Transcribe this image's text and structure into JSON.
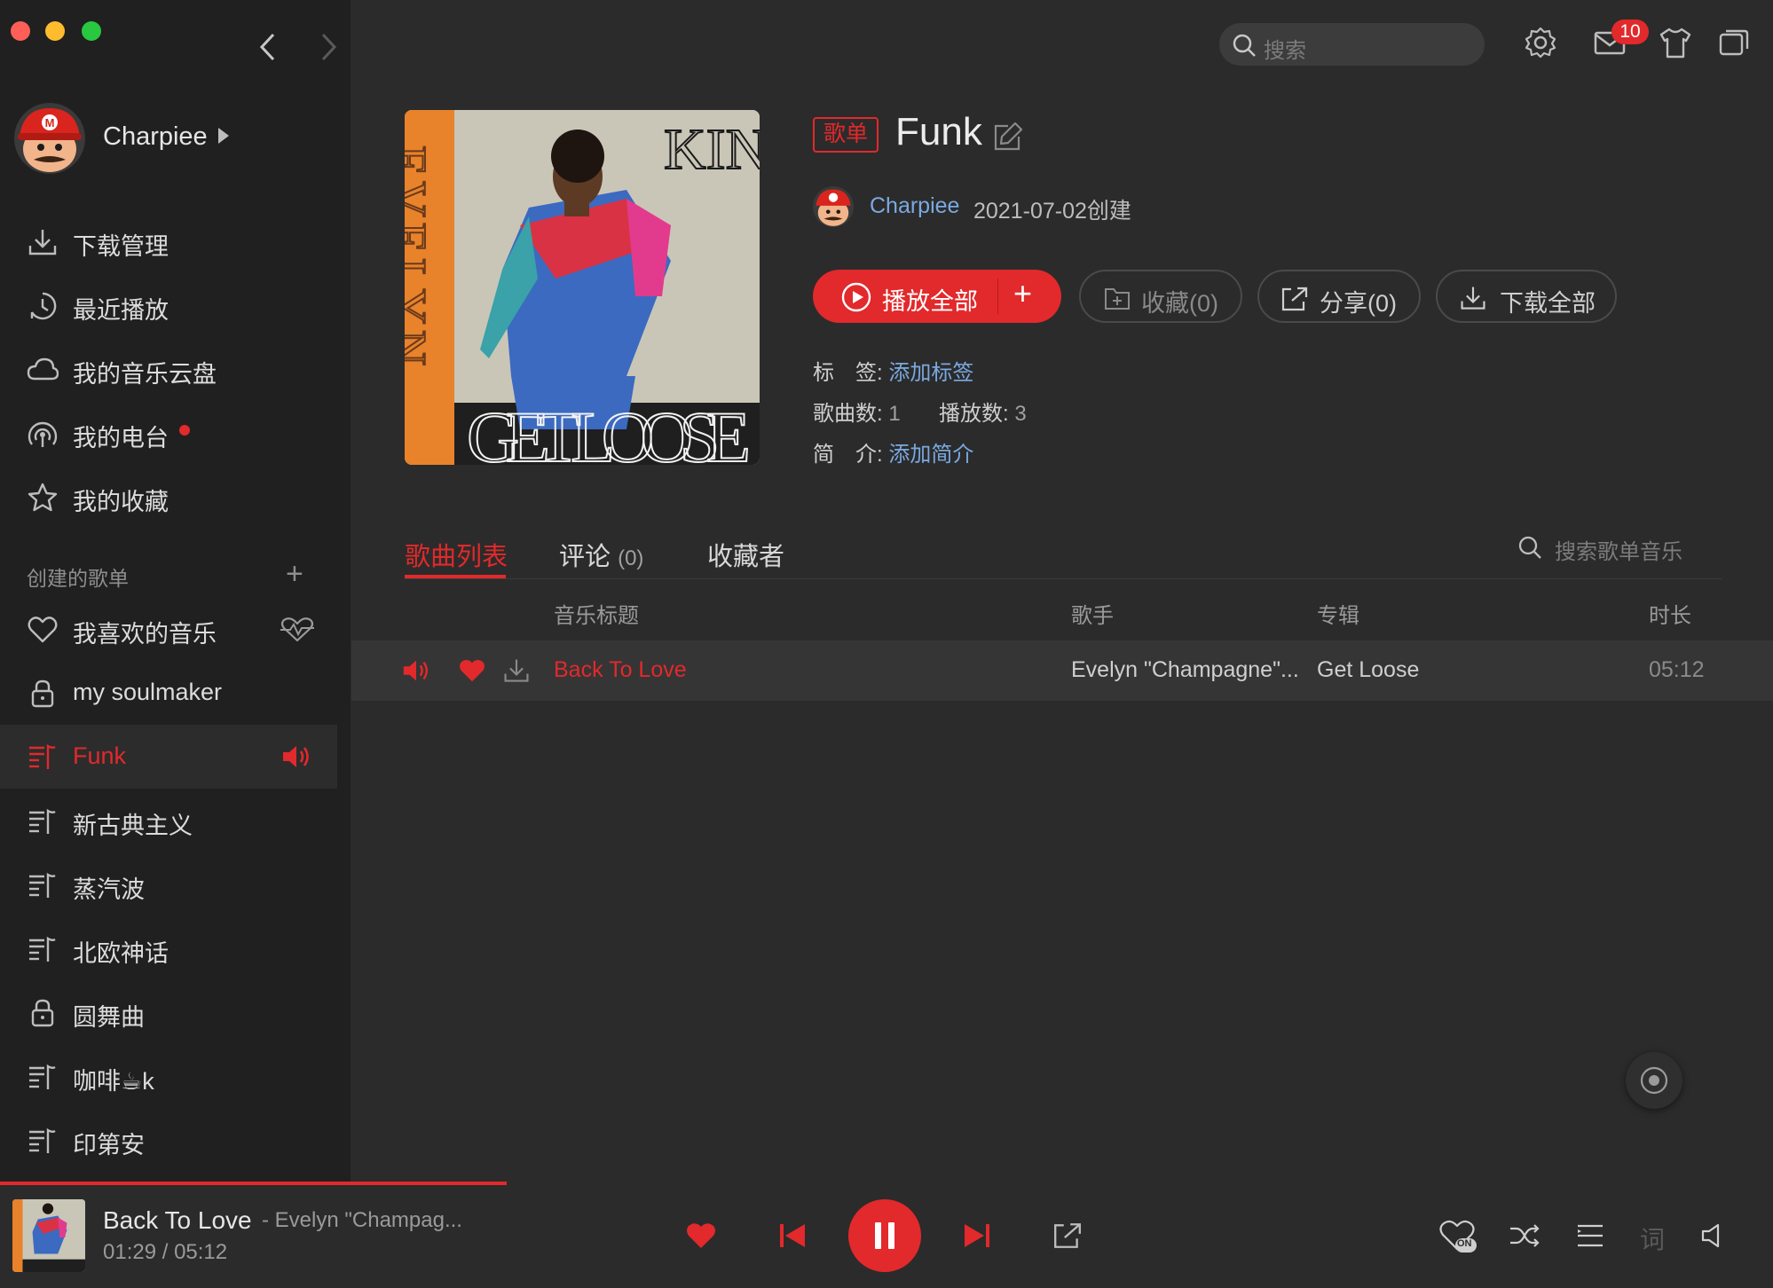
{
  "window": {
    "traffic_colors": [
      "#ff5f57",
      "#febc2e",
      "#28c840"
    ]
  },
  "header": {
    "search_placeholder": "搜索",
    "mail_badge": "10",
    "icons": [
      "chevron-left-icon",
      "chevron-right-icon",
      "search-icon",
      "gear-icon",
      "mail-icon",
      "tshirt-icon",
      "mini-window-icon"
    ]
  },
  "sidebar": {
    "user": {
      "name": "Charpiee"
    },
    "menu": [
      {
        "label": "下载管理",
        "icon": "download-icon"
      },
      {
        "label": "最近播放",
        "icon": "recent-icon"
      },
      {
        "label": "我的音乐云盘",
        "icon": "cloud-icon"
      },
      {
        "label": "我的电台",
        "icon": "radio-icon",
        "dot": true
      },
      {
        "label": "我的收藏",
        "icon": "star-icon"
      }
    ],
    "created_section": "创建的歌单",
    "playlists": [
      {
        "label": "我喜欢的音乐",
        "icon": "heart-icon"
      },
      {
        "label": "my soulmaker",
        "icon": "lock-icon"
      },
      {
        "label": "Funk",
        "icon": "playlist-icon",
        "active": true
      },
      {
        "label": "新古典主义",
        "icon": "playlist-icon"
      },
      {
        "label": "蒸汽波",
        "icon": "playlist-icon"
      },
      {
        "label": "北欧神话",
        "icon": "playlist-icon"
      },
      {
        "label": "圆舞曲",
        "icon": "lock-icon"
      },
      {
        "label": "咖啡☕k",
        "icon": "playlist-icon"
      },
      {
        "label": "印第安",
        "icon": "playlist-icon"
      }
    ]
  },
  "playlist": {
    "tag": "歌单",
    "title": "Funk",
    "creator": "Charpiee",
    "created": "2021-07-02创建",
    "cover_text_top": "KING",
    "cover_text_side": "EVELYN",
    "cover_text_bottom": "GET LOOSE",
    "buttons": {
      "play_all": "播放全部",
      "add": "+",
      "collect": "收藏(0)",
      "share": "分享(0)",
      "download_all": "下载全部"
    },
    "tags_label": "标　签:",
    "tags_link": "添加标签",
    "count_label": "歌曲数:",
    "count_value": "1",
    "plays_label": "播放数:",
    "plays_value": "3",
    "intro_label": "简　介:",
    "intro_link": "添加简介"
  },
  "tabs": [
    {
      "label": "歌曲列表",
      "active": true
    },
    {
      "label": "评论",
      "count": "(0)"
    },
    {
      "label": "收藏者"
    }
  ],
  "list_search_placeholder": "搜索歌单音乐",
  "table": {
    "columns": [
      "音乐标题",
      "歌手",
      "专辑",
      "时长"
    ],
    "rows": [
      {
        "title": "Back To Love",
        "artist": "Evelyn \"Champagne\"...",
        "album": "Get Loose",
        "duration": "05:12",
        "playing": true,
        "liked": true
      }
    ]
  },
  "player": {
    "title": "Back To Love",
    "artist": "- Evelyn \"Champag...",
    "time": "01:29 /  05:12",
    "progress": 0.286,
    "mode_badge": "ON",
    "lyric_label": "词"
  },
  "colors": {
    "accent": "#e2292b",
    "link": "#7aa9e0",
    "sidebar_bg": "#202020",
    "main_bg": "#2b2b2b"
  }
}
